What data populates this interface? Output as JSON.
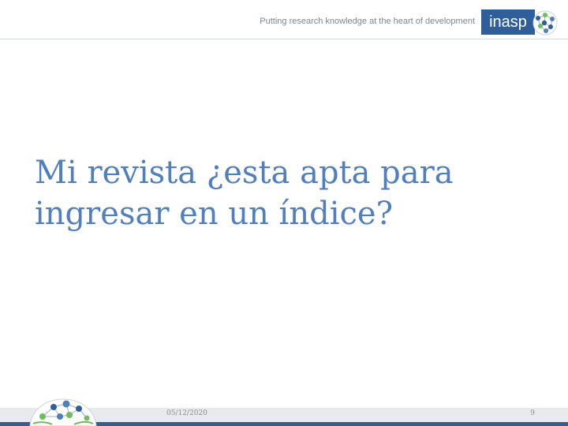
{
  "header": {
    "tagline": "Putting research knowledge at the heart of development",
    "brand": "inasp"
  },
  "slide": {
    "title": "Mi revista ¿esta apta para ingresar en un índice?"
  },
  "footer": {
    "date": "05/12/2020",
    "page_number": "9"
  },
  "colors": {
    "title": "#4f7fc1",
    "brand": "#2f5f9a",
    "footer_bar": "#e8eaed"
  },
  "icons": {
    "header_logo": "globe-network-icon",
    "footer_logo": "globe-network-icon"
  }
}
